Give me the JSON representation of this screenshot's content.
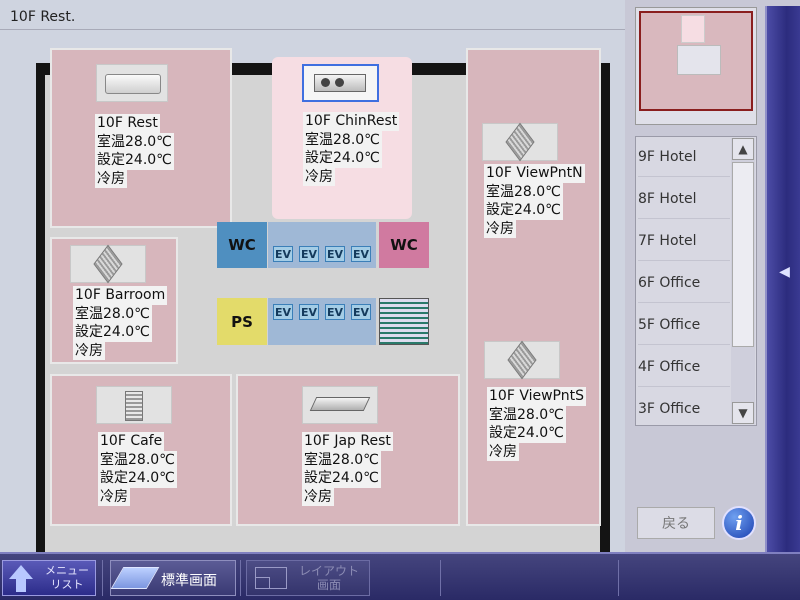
{
  "header": {
    "title": "10F Rest."
  },
  "rooms": [
    {
      "name": "10F Rest",
      "temp": "室温28.0℃",
      "setpoint": "設定24.0℃",
      "mode": "冷房"
    },
    {
      "name": "10F ChinRest",
      "temp": "室温28.0℃",
      "setpoint": "設定24.0℃",
      "mode": "冷房"
    },
    {
      "name": "10F ViewPntN",
      "temp": "室温28.0℃",
      "setpoint": "設定24.0℃",
      "mode": "冷房"
    },
    {
      "name": "10F Barroom",
      "temp": "室温28.0℃",
      "setpoint": "設定24.0℃",
      "mode": "冷房"
    },
    {
      "name": "10F ViewPntS",
      "temp": "室温28.0℃",
      "setpoint": "設定24.0℃",
      "mode": "冷房"
    },
    {
      "name": "10F Cafe",
      "temp": "室温28.0℃",
      "setpoint": "設定24.0℃",
      "mode": "冷房"
    },
    {
      "name": "10F Jap Rest",
      "temp": "室温28.0℃",
      "setpoint": "設定24.0℃",
      "mode": "冷房"
    }
  ],
  "core": {
    "wc": "WC",
    "ps": "PS",
    "ev": "EV"
  },
  "floor_list": [
    "9F Hotel",
    "8F Hotel",
    "7F Hotel",
    "6F Office",
    "5F Office",
    "4F Office",
    "3F Office"
  ],
  "buttons": {
    "back": "戻る",
    "info": "i"
  },
  "bottom_bar": {
    "menu_line1": "メニュー",
    "menu_line2": "リスト",
    "standard": "標準画面",
    "layout_line1": "レイアウト",
    "layout_line2": "画面"
  },
  "icons": {
    "menu": "up-arrow-icon",
    "standard": "standard-screen-icon",
    "layout": "layout-screen-icon",
    "info": "info-icon",
    "side_tab": "triangle-left-icon"
  },
  "colors": {
    "room": "#d7b6bc",
    "room_selected": "#f6dde3",
    "selection_border": "#3f6fe0",
    "wc_blue": "#4f8fc0",
    "wc_pink": "#d07aa0",
    "ps_yellow": "#e3db6a",
    "nav_bar": "#2a2a66"
  }
}
